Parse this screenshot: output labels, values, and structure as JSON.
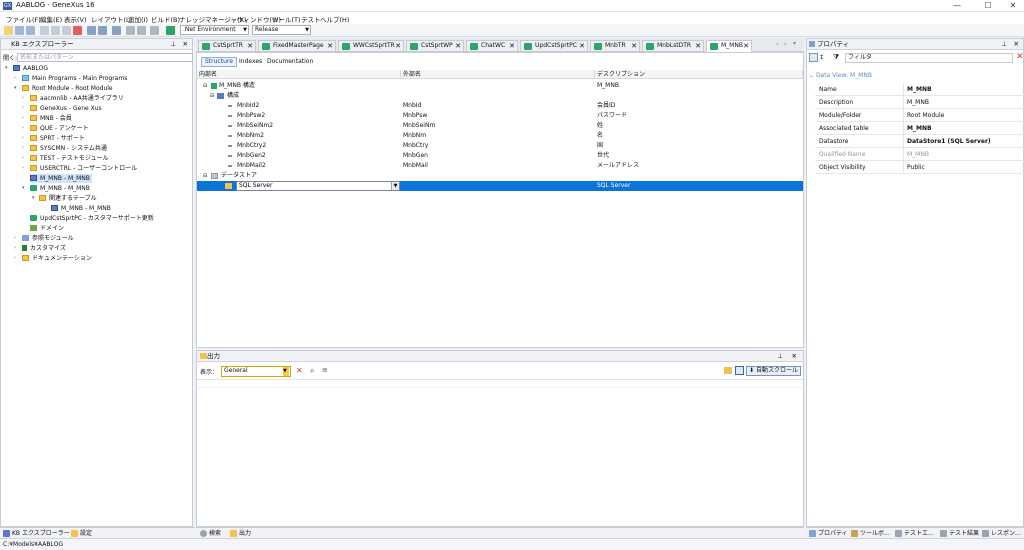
{
  "window": {
    "title": "AABLOG - GeneXus 16",
    "app_icon": "GX"
  },
  "menu": [
    "ファイル(F)",
    "編集(E)",
    "表示(V)",
    "レイアウト(L)",
    "追加(I)",
    "ビルド(B)",
    "ナレッジマネージャ(K)",
    "ウィンドウ(W)",
    "ツール(T)",
    "テスト",
    "ヘルプ(H)"
  ],
  "toolbar": {
    "environment": ".Net Environment",
    "configuration": "Release"
  },
  "kb_explorer": {
    "title": "KB エクスプローラー",
    "search_label": "開く:",
    "search_placeholder": "名前またはパターン",
    "items": [
      {
        "label": "AABLOG"
      },
      {
        "label": "Main Programs - Main Programs"
      },
      {
        "label": "Root Module - Root Module"
      },
      {
        "label": "aacmnlib - AA共通ライブラリ"
      },
      {
        "label": "GeneXus - Gene Xus"
      },
      {
        "label": "MNB - 会員"
      },
      {
        "label": "QUE - アンケート"
      },
      {
        "label": "SPRT - サポート"
      },
      {
        "label": "SYSCMN - システム共通"
      },
      {
        "label": "TEST - テストモジュール"
      },
      {
        "label": "USERCTRL - ユーザーコントロール"
      },
      {
        "label": "M_MNB - M_MNB"
      },
      {
        "label": "M_MNB - M_MNB"
      },
      {
        "label": "関連するテーブル"
      },
      {
        "label": "M_MNB - M_MNB"
      },
      {
        "label": "UpdCstSprtPC - カスタマーサポート更新"
      },
      {
        "label": "ドメイン"
      },
      {
        "label": "参照モジュール"
      },
      {
        "label": "カスタマイズ"
      },
      {
        "label": "ドキュメンテーション"
      }
    ]
  },
  "tabs": [
    {
      "label": "CstSprtTR"
    },
    {
      "label": "FixedMasterPage"
    },
    {
      "label": "WWCstSprtTR"
    },
    {
      "label": "CstSprtWP"
    },
    {
      "label": "ChatWC"
    },
    {
      "label": "UpdCstSprtPC"
    },
    {
      "label": "MnbTR"
    },
    {
      "label": "MnbLstDTR"
    },
    {
      "label": "M_MNB"
    }
  ],
  "editor": {
    "subtabs": [
      "Structure",
      "Indexes",
      "Documentation"
    ],
    "columns": [
      "内部名",
      "外部名",
      "デスクリプション"
    ],
    "structure_root": {
      "name": "M_MNB 構造",
      "desc": "M_MNB"
    },
    "composition_label": "構成",
    "attributes": [
      {
        "name": "MnbId2",
        "ext": "MnbId",
        "desc": "会員ID"
      },
      {
        "name": "MnbPsw2",
        "ext": "MnbPsw",
        "desc": "パスワード"
      },
      {
        "name": "MnbSeiNm2",
        "ext": "MnbSeiNm",
        "desc": "姓"
      },
      {
        "name": "MnbNm2",
        "ext": "MnbNm",
        "desc": "名"
      },
      {
        "name": "MnbCtry2",
        "ext": "MnbCtry",
        "desc": "国"
      },
      {
        "name": "MnbGen2",
        "ext": "MnbGen",
        "desc": "世代"
      },
      {
        "name": "MnbMail2",
        "ext": "MnbMail",
        "desc": "メールアドレス"
      }
    ],
    "datastore_label": "データストア",
    "datastore_value": "SQL Server",
    "datastore_desc": "SQL Server"
  },
  "output": {
    "title": "出力",
    "show_label": "表示：",
    "show_value": "General",
    "autoscroll": "自動スクロール"
  },
  "properties": {
    "title": "プロパティ",
    "filter": "フィルタ",
    "section": "Data View: M_MNB",
    "rows": [
      {
        "key": "Name",
        "value": "M_MNB",
        "bold": true
      },
      {
        "key": "Description",
        "value": "M_MNB",
        "bold": false
      },
      {
        "key": "Module/Folder",
        "value": "Root Module",
        "bold": false
      },
      {
        "key": "Associated table",
        "value": "M_MNB",
        "bold": true
      },
      {
        "key": "Datastore",
        "value": "DataStore1 (SQL Server)",
        "bold": true
      },
      {
        "key": "Qualified Name",
        "value": "M_MNB",
        "bold": false,
        "disabled": true
      },
      {
        "key": "Object Visibility",
        "value": "Public",
        "bold": false
      }
    ]
  },
  "bottom_tabs_left": [
    "KB エクスプローラー",
    "設定"
  ],
  "bottom_tabs_mid": [
    "検索",
    "出力"
  ],
  "bottom_tabs_right": [
    "プロパティ",
    "ツールボ...",
    "テストエ...",
    "テスト結果",
    "レスポン..."
  ],
  "status": "C:¥Models¥AABLOG",
  "colors": {
    "selection": "#0a74d8",
    "accent": "#2ea36a",
    "folder": "#f2c24d"
  }
}
